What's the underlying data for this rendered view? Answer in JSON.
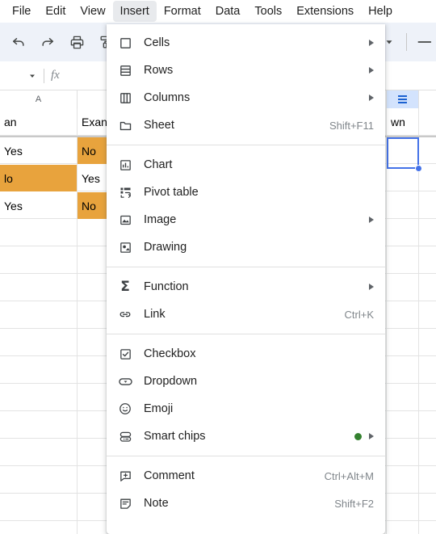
{
  "menubar": {
    "items": [
      {
        "label": "File",
        "active": false
      },
      {
        "label": "Edit",
        "active": false
      },
      {
        "label": "View",
        "active": false
      },
      {
        "label": "Insert",
        "active": true
      },
      {
        "label": "Format",
        "active": false
      },
      {
        "label": "Data",
        "active": false
      },
      {
        "label": "Tools",
        "active": false
      },
      {
        "label": "Extensions",
        "active": false
      },
      {
        "label": "Help",
        "active": false
      }
    ]
  },
  "toolbar": {
    "icons": [
      "undo-icon",
      "redo-icon",
      "print-icon",
      "paint-format-icon"
    ],
    "right_icons": [
      "chevron-down-icon",
      "minus-icon"
    ]
  },
  "formulabar": {
    "namebox_caret": "chevron-down-icon",
    "fx_label": "fx",
    "value": ""
  },
  "grid": {
    "columns": [
      {
        "label": "A",
        "selected": false
      },
      {
        "label": "",
        "selected": false
      },
      {
        "label": "",
        "selected": true
      },
      {
        "label": "",
        "selected": false
      }
    ],
    "header_row": [
      "an",
      "Exan",
      "wn"
    ],
    "rows": [
      {
        "cells": [
          {
            "text": "Yes",
            "fill": "none"
          },
          {
            "text": "No",
            "fill": "orange"
          }
        ]
      },
      {
        "cells": [
          {
            "text": "lo",
            "fill": "orange"
          },
          {
            "text": "Yes",
            "fill": "none"
          }
        ]
      },
      {
        "cells": [
          {
            "text": "Yes",
            "fill": "none"
          },
          {
            "text": "No",
            "fill": "orange"
          }
        ]
      }
    ],
    "fill_color": "#e8a33d",
    "selection_color": "#4472e8",
    "selected_header_color": "#d3e3fd"
  },
  "menu": {
    "sections": [
      {
        "items": [
          {
            "icon": "cells-icon",
            "label": "Cells",
            "accel": "",
            "submenu": true,
            "dot": false
          },
          {
            "icon": "rows-icon",
            "label": "Rows",
            "accel": "",
            "submenu": true,
            "dot": false
          },
          {
            "icon": "columns-icon",
            "label": "Columns",
            "accel": "",
            "submenu": true,
            "dot": false
          },
          {
            "icon": "sheet-icon",
            "label": "Sheet",
            "accel": "Shift+F11",
            "submenu": false,
            "dot": false
          }
        ]
      },
      {
        "items": [
          {
            "icon": "chart-icon",
            "label": "Chart",
            "accel": "",
            "submenu": false,
            "dot": false
          },
          {
            "icon": "pivot-table-icon",
            "label": "Pivot table",
            "accel": "",
            "submenu": false,
            "dot": false
          },
          {
            "icon": "image-icon",
            "label": "Image",
            "accel": "",
            "submenu": true,
            "dot": false
          },
          {
            "icon": "drawing-icon",
            "label": "Drawing",
            "accel": "",
            "submenu": false,
            "dot": false
          }
        ]
      },
      {
        "items": [
          {
            "icon": "function-icon",
            "label": "Function",
            "accel": "",
            "submenu": true,
            "dot": false
          },
          {
            "icon": "link-icon",
            "label": "Link",
            "accel": "Ctrl+K",
            "submenu": false,
            "dot": false
          }
        ]
      },
      {
        "items": [
          {
            "icon": "checkbox-icon",
            "label": "Checkbox",
            "accel": "",
            "submenu": false,
            "dot": false
          },
          {
            "icon": "dropdown-icon",
            "label": "Dropdown",
            "accel": "",
            "submenu": false,
            "dot": false
          },
          {
            "icon": "emoji-icon",
            "label": "Emoji",
            "accel": "",
            "submenu": false,
            "dot": false
          },
          {
            "icon": "smart-chips-icon",
            "label": "Smart chips",
            "accel": "",
            "submenu": true,
            "dot": true
          }
        ]
      },
      {
        "items": [
          {
            "icon": "comment-icon",
            "label": "Comment",
            "accel": "Ctrl+Alt+M",
            "submenu": false,
            "dot": false
          },
          {
            "icon": "note-icon",
            "label": "Note",
            "accel": "Shift+F2",
            "submenu": false,
            "dot": false
          }
        ]
      }
    ],
    "badge_color": "#34812f"
  }
}
